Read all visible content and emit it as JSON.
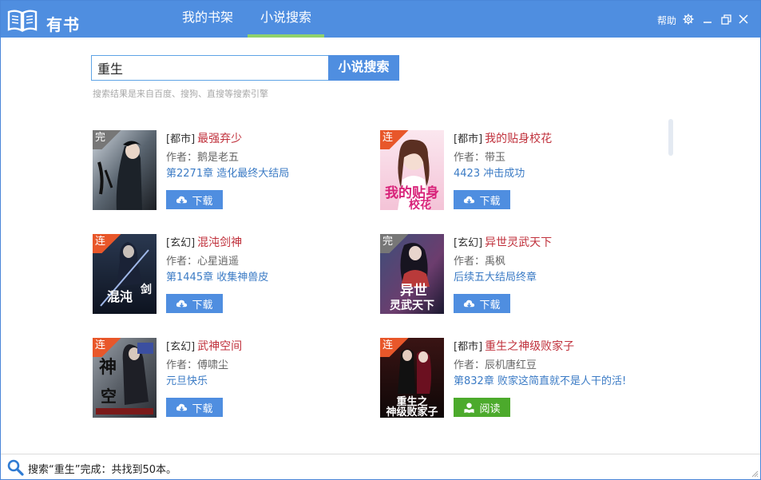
{
  "app": {
    "title": "有书"
  },
  "tabs": [
    {
      "label": "我的书架",
      "active": false
    },
    {
      "label": "小说搜索",
      "active": true
    }
  ],
  "window_controls": {
    "help_label": "帮助"
  },
  "search": {
    "query": "重生",
    "button_label": "小说搜索",
    "hint": "搜索结果是来自百度、搜狗、直搜等搜索引擎"
  },
  "books": [
    {
      "status": "完",
      "category": "[都市]",
      "title": "最强弃少",
      "author": "作者：鹅是老五",
      "chapter": "第2271章 造化最终大结局",
      "action": "下载"
    },
    {
      "status": "连",
      "category": "[都市]",
      "title": "我的贴身校花",
      "author": "作者：带玉",
      "chapter": "4423 冲击成功",
      "action": "下载"
    },
    {
      "status": "连",
      "category": "[玄幻]",
      "title": "混沌剑神",
      "author": "作者：心星逍遥",
      "chapter": "第1445章 收集神兽皮",
      "action": "下载"
    },
    {
      "status": "完",
      "category": "[玄幻]",
      "title": "异世灵武天下",
      "author": "作者：禹枫",
      "chapter": "后续五大结局终章",
      "action": "下载"
    },
    {
      "status": "连",
      "category": "[玄幻]",
      "title": "武神空间",
      "author": "作者：傅啸尘",
      "chapter": "元旦快乐",
      "action": "下载"
    },
    {
      "status": "连",
      "category": "[都市]",
      "title": "重生之神级败家子",
      "author": "作者：辰机唐红豆",
      "chapter": "第832章 败家这简直就不是人干的活!",
      "action": "阅读"
    }
  ],
  "status_bar": {
    "text": "搜索“重生”完成：共找到50本。"
  },
  "colors": {
    "accent": "#4f8ee0",
    "title_red": "#c0313c",
    "read_green": "#4caa2c",
    "tab_underline": "#8fd16a"
  }
}
